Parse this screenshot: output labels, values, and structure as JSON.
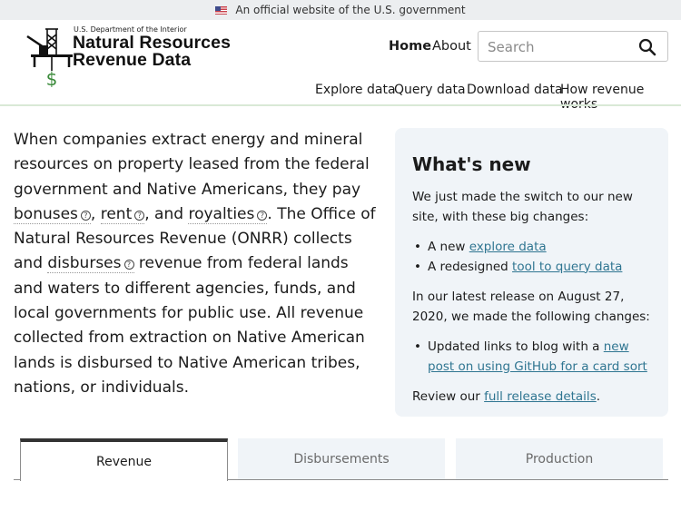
{
  "gov_banner": {
    "text": "An official website of the U.S. government",
    "icon": "us-flag-icon"
  },
  "header": {
    "department": "U.S. Department of the Interior",
    "title_line1": "Natural Resources",
    "title_line2": "Revenue Data",
    "logo_icon": "oil-rig-dollar-icon",
    "nav_primary": [
      {
        "label": "Home",
        "active": true
      },
      {
        "label": "About"
      }
    ],
    "search": {
      "placeholder": "Search",
      "value": "",
      "icon": "search-icon"
    },
    "nav_secondary": [
      {
        "label": "Explore data"
      },
      {
        "label": "Query data"
      },
      {
        "label": "Download data"
      },
      {
        "label": "How revenue works"
      }
    ]
  },
  "intro": {
    "part1": "When companies extract energy and mineral resources on property leased from the federal government and Native Americans, they pay ",
    "term_bonuses": "bonuses",
    "sep1": ", ",
    "term_rent": "rent",
    "sep2": ", and ",
    "term_royalties": "royalties",
    "part2": ". The Office of Natural Resources Revenue (ONRR) collects and ",
    "term_disburses": "disburses",
    "part3": " revenue from federal lands and waters to different agencies, funds, and local governments for public use. All revenue collected from extraction on Native American lands is disbursed to Native American tribes, nations, or individuals.",
    "help_glyph": "?"
  },
  "whats_new": {
    "title": "What's new",
    "intro": "We just made the switch to our new site, with these big changes:",
    "changes": [
      {
        "prefix": "A new ",
        "link": "explore data"
      },
      {
        "prefix": "A redesigned ",
        "link": "tool to query data"
      }
    ],
    "release_text": "In our latest release on August 27, 2020, we made the following changes:",
    "release_items": [
      {
        "prefix": "Updated links to blog with a ",
        "link": "new post on using GitHub for a card sort"
      }
    ],
    "review_prefix": "Review our ",
    "review_link": "full release details",
    "review_suffix": ".",
    "link_color": "#2f7591"
  },
  "tabs": [
    {
      "label": "Revenue",
      "active": true
    },
    {
      "label": "Disbursements",
      "active": false
    },
    {
      "label": "Production",
      "active": false
    }
  ]
}
